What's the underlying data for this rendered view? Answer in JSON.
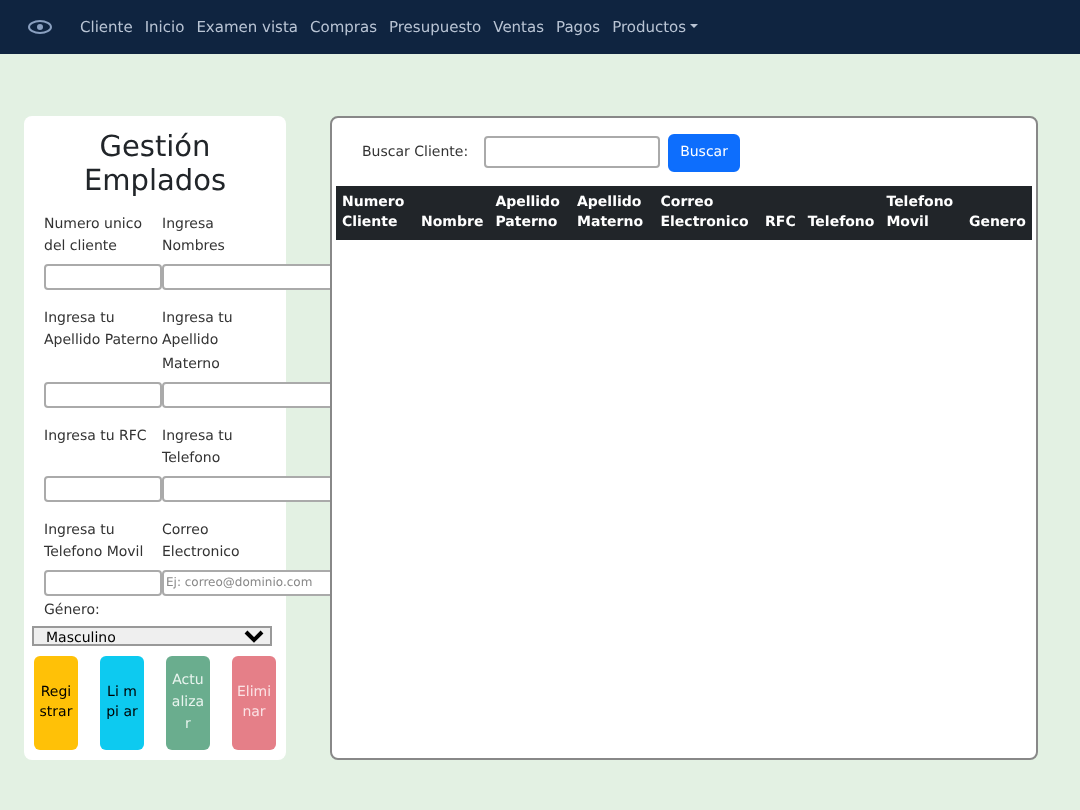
{
  "navbar": {
    "links": [
      {
        "label": "Cliente"
      },
      {
        "label": "Inicio"
      },
      {
        "label": "Examen vista"
      },
      {
        "label": "Compras"
      },
      {
        "label": "Presupuesto"
      },
      {
        "label": "Ventas"
      },
      {
        "label": "Pagos"
      },
      {
        "label": "Productos",
        "dropdown": true
      }
    ]
  },
  "form": {
    "title": "Gestión Emplados",
    "fields": [
      {
        "label": "Numero unico del cliente"
      },
      {
        "label": "Ingresa Nombres"
      },
      {
        "label": "Ingresa tu Apellido Paterno"
      },
      {
        "label": "Ingresa tu Apellido Materno"
      },
      {
        "label": "Ingresa tu RFC"
      },
      {
        "label": "Ingresa tu Telefono"
      },
      {
        "label": "Ingresa tu Telefono Movil"
      },
      {
        "label": "Correo Electronico",
        "placeholder": "Ej: correo@dominio.com"
      }
    ],
    "gender": {
      "label": "Género:",
      "value": "Masculino"
    },
    "buttons": [
      {
        "label": "Regi strar",
        "kind": "warning"
      },
      {
        "label": "Li m pi ar",
        "kind": "info"
      },
      {
        "label": "Actu aliza r",
        "kind": "success"
      },
      {
        "label": "Elimi nar",
        "kind": "danger"
      }
    ]
  },
  "search": {
    "label": "Buscar Cliente:",
    "button": "Buscar"
  },
  "table": {
    "columns": [
      "Numero Cliente",
      "Nombre",
      "Apellido Paterno",
      "Apellido Materno",
      "Correo Electronico",
      "RFC",
      "Telefono",
      "Telefono Movil",
      "Genero"
    ]
  }
}
